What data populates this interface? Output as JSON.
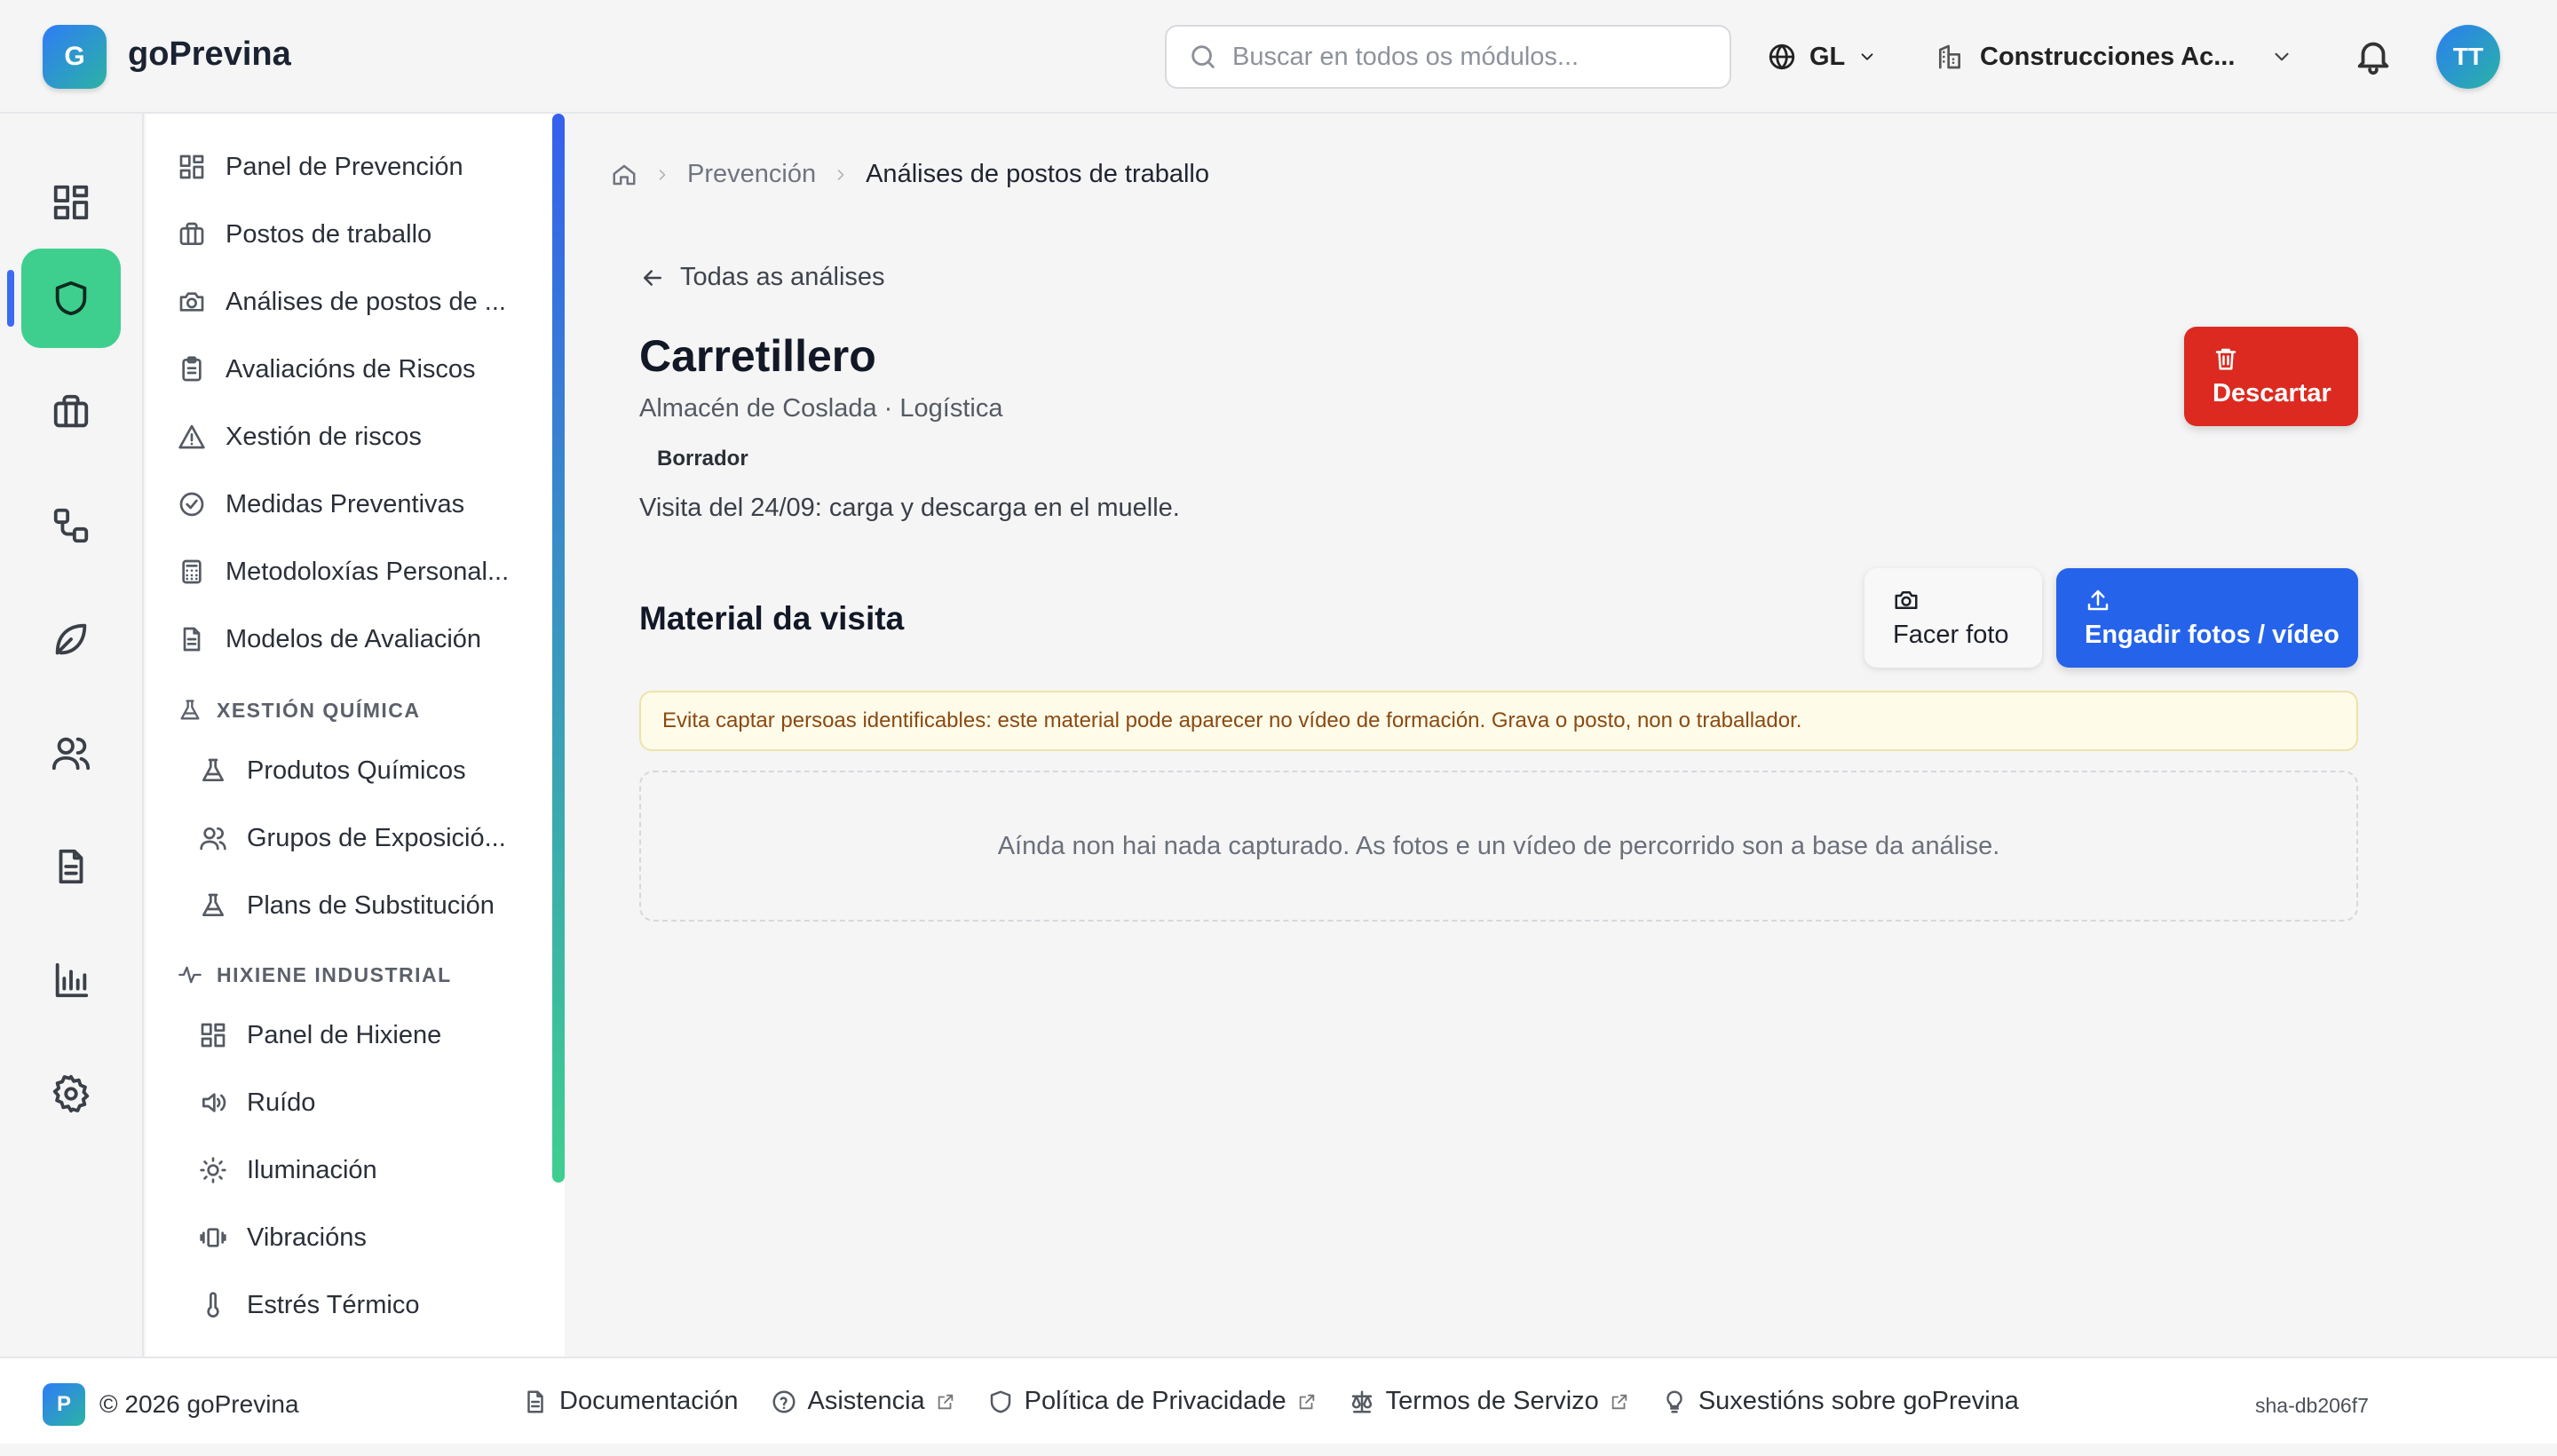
{
  "header": {
    "logo_letter": "G",
    "app_title": "goPrevina",
    "search_placeholder": "Buscar en todos os módulos...",
    "language": "GL",
    "organization": "Construcciones Ac...",
    "avatar_initials": "TT"
  },
  "rail": {
    "items": [
      "dashboard-icon",
      "shield-icon",
      "briefcase-icon",
      "workflow-icon",
      "leaf-icon",
      "users-icon",
      "document-icon",
      "chart-icon",
      "gear-icon"
    ],
    "active_index": 1
  },
  "nav": {
    "items": [
      "Panel de Prevención",
      "Postos de traballo",
      "Análises de postos de ...",
      "Avaliacións de Riscos",
      "Xestión de riscos",
      "Medidas Preventivas",
      "Metodoloxías Personal...",
      "Modelos de Avaliación"
    ],
    "section_chem": "XESTIÓN QUÍMICA",
    "chem_items": [
      "Produtos Químicos",
      "Grupos de Exposició...",
      "Plans de Substitución"
    ],
    "section_hyg": "HIXIENE INDUSTRIAL",
    "hyg_items": [
      "Panel de Hixiene",
      "Ruído",
      "Iluminación",
      "Vibracións",
      "Estrés Térmico"
    ]
  },
  "breadcrumb": {
    "parent": "Prevención",
    "current": "Análises de postos de traballo"
  },
  "page": {
    "back_label": "Todas as análises",
    "title": "Carretillero",
    "subtitle": "Almacén de Coslada · Logística",
    "status_badge": "Borrador",
    "description": "Visita del 24/09: carga y descarga en el muelle.",
    "discard_label": "Descartar",
    "section_title": "Material da visita",
    "take_photo_label": "Facer foto",
    "upload_label": "Engadir fotos / vídeo",
    "warning": "Evita captar persoas identificables: este material pode aparecer no vídeo de formación. Grava o posto, non o traballador.",
    "empty_state": "Aínda non hai nada capturado. As fotos e un vídeo de percorrido son a base da análise."
  },
  "footer": {
    "badge_letter": "P",
    "copyright": "© 2026 goPrevina",
    "links": [
      "Documentación",
      "Asistencia",
      "Política de Privacidade",
      "Termos de Servizo",
      "Suxestións sobre goPrevina"
    ],
    "version": "sha-db206f7"
  },
  "colors": {
    "active_rail": "#3ecf8e",
    "primary": "#2563eb",
    "danger": "#dc2a20",
    "warning_bg": "#fefbe9",
    "warning_text": "#8a4a12"
  }
}
